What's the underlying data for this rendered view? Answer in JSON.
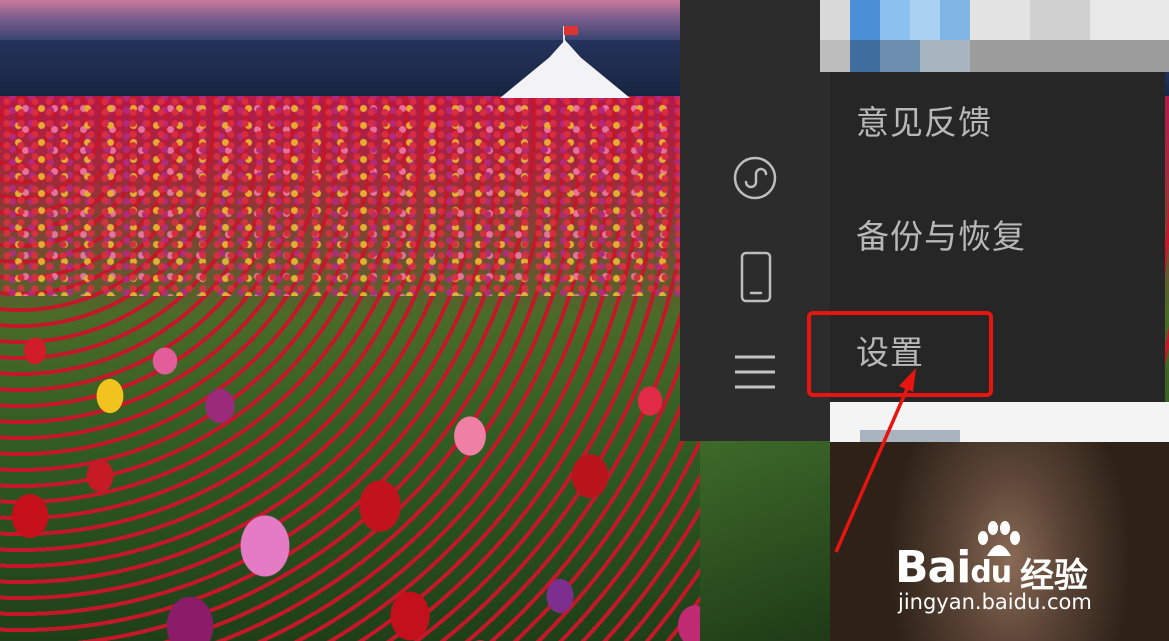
{
  "menu": {
    "items": [
      {
        "label": "意见反馈"
      },
      {
        "label": "备份与恢复"
      },
      {
        "label": "设置"
      }
    ],
    "highlighted_item": "设置"
  },
  "rail": {
    "icons": [
      "mini-program-icon",
      "phone-icon",
      "menu-icon"
    ]
  },
  "watermark": {
    "brand": "Bai",
    "brand_du": "du",
    "cn": "经验",
    "url": "jingyan.baidu.com"
  },
  "colors": {
    "panel_bg": "#262626",
    "rail_bg": "#2c2c2c",
    "menu_text": "#b8b8b8",
    "annotation_red": "#e8140f"
  }
}
